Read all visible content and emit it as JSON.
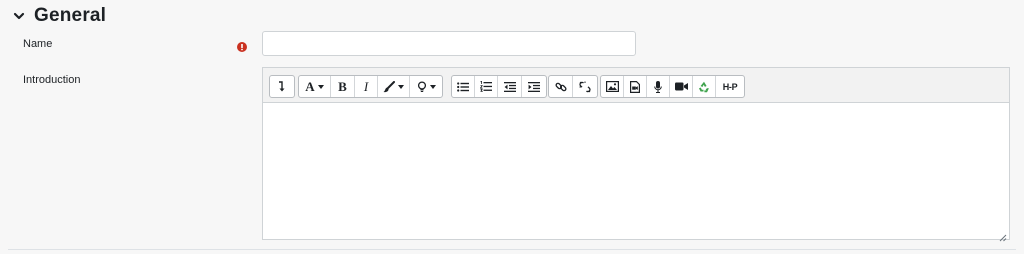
{
  "section": {
    "title": "General"
  },
  "fields": {
    "name": {
      "label": "Name",
      "value": "",
      "placeholder": ""
    },
    "introduction": {
      "label": "Introduction"
    }
  },
  "toolbar": {
    "font_letter": "A",
    "bold_letter": "B",
    "italic_letter": "I",
    "h5p_label": "H-P"
  },
  "colors": {
    "required": "#ca3120",
    "recycle": "#3fa34d"
  }
}
